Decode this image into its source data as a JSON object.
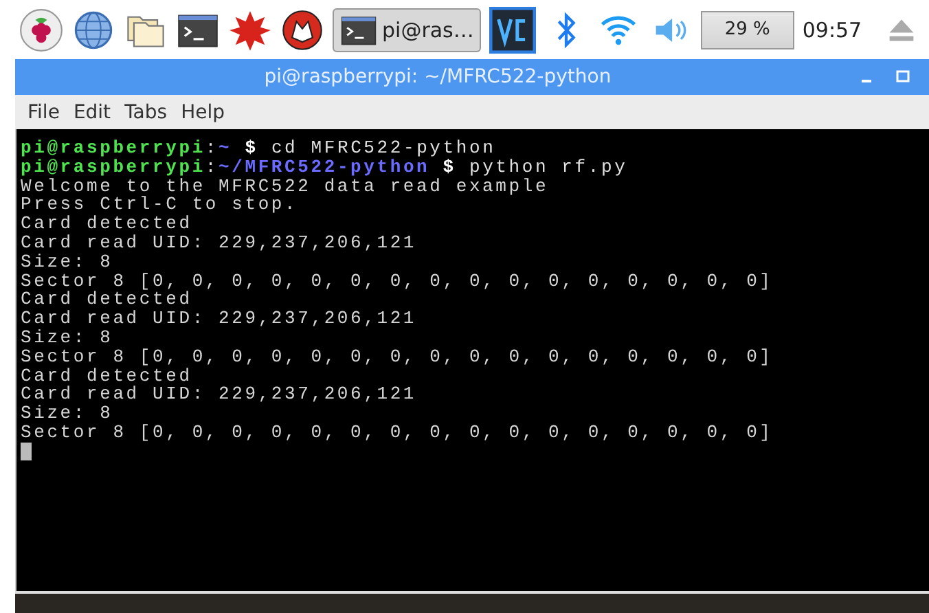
{
  "taskbar": {
    "launchers": [
      {
        "kind": "raspberry"
      },
      {
        "kind": "globe"
      },
      {
        "kind": "folders"
      },
      {
        "kind": "terminal"
      },
      {
        "kind": "star"
      },
      {
        "kind": "wolf"
      }
    ],
    "task_buttons": [
      {
        "label": "pi@ras…",
        "selected": true
      }
    ],
    "tray": [
      {
        "kind": "vnc"
      },
      {
        "kind": "bluetooth"
      },
      {
        "kind": "wifi"
      },
      {
        "kind": "volume"
      }
    ],
    "cpu": "29 %",
    "clock": "09:57"
  },
  "window": {
    "title": "pi@raspberrypi: ~/MFRC522-python",
    "menu": [
      "File",
      "Edit",
      "Tabs",
      "Help"
    ]
  },
  "terminal": {
    "lines": [
      {
        "kind": "prompt",
        "host": "pi@raspberrypi",
        "sep": ":",
        "path": "~",
        "dollar": "$",
        "command": "cd MFRC522-python"
      },
      {
        "kind": "prompt",
        "host": "pi@raspberrypi",
        "sep": ":",
        "path": "~/MFRC522-python",
        "dollar": "$",
        "command": "python rf.py"
      },
      {
        "kind": "output",
        "text": "Welcome to the MFRC522 data read example"
      },
      {
        "kind": "output",
        "text": "Press Ctrl-C to stop."
      },
      {
        "kind": "output",
        "text": "Card detected"
      },
      {
        "kind": "output",
        "text": "Card read UID: 229,237,206,121"
      },
      {
        "kind": "output",
        "text": "Size: 8"
      },
      {
        "kind": "output",
        "text": "Sector 8 [0, 0, 0, 0, 0, 0, 0, 0, 0, 0, 0, 0, 0, 0, 0, 0]"
      },
      {
        "kind": "output",
        "text": "Card detected"
      },
      {
        "kind": "output",
        "text": "Card read UID: 229,237,206,121"
      },
      {
        "kind": "output",
        "text": "Size: 8"
      },
      {
        "kind": "output",
        "text": "Sector 8 [0, 0, 0, 0, 0, 0, 0, 0, 0, 0, 0, 0, 0, 0, 0, 0]"
      },
      {
        "kind": "output",
        "text": "Card detected"
      },
      {
        "kind": "output",
        "text": "Card read UID: 229,237,206,121"
      },
      {
        "kind": "output",
        "text": "Size: 8"
      },
      {
        "kind": "output",
        "text": "Sector 8 [0, 0, 0, 0, 0, 0, 0, 0, 0, 0, 0, 0, 0, 0, 0, 0]"
      },
      {
        "kind": "cursor"
      }
    ]
  }
}
